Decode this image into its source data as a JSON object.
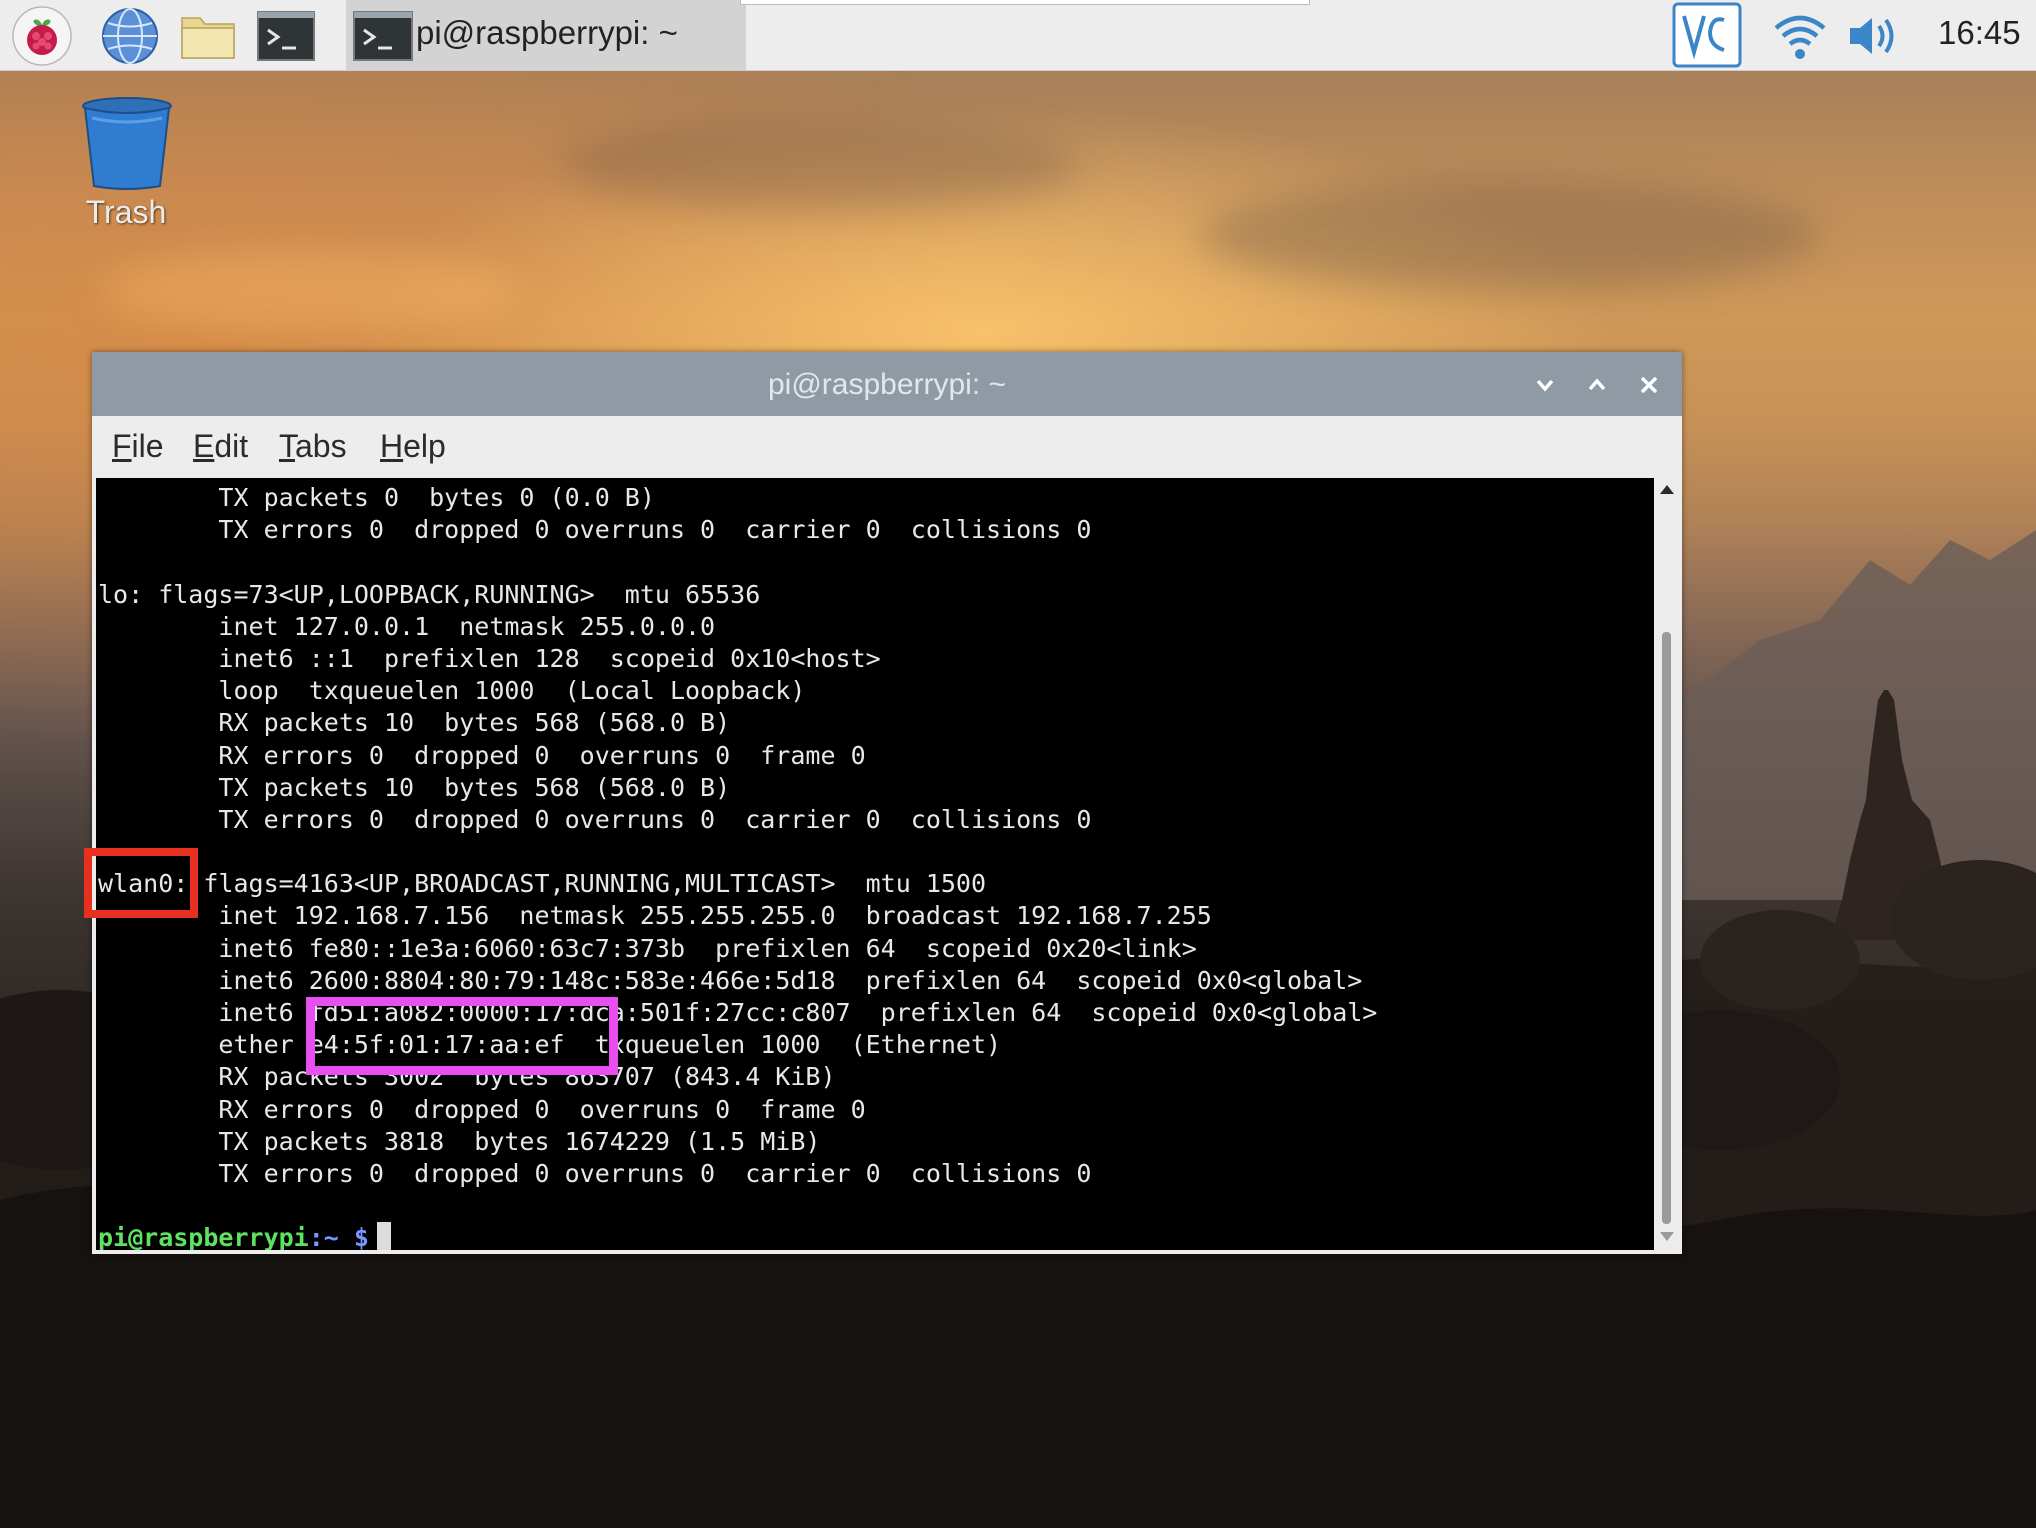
{
  "taskbar": {
    "launchers": [
      "raspberry-menu",
      "web-browser",
      "file-manager",
      "terminal"
    ],
    "window_button_title": "pi@raspberrypi: ~",
    "tray": [
      "vnc",
      "wifi",
      "volume"
    ],
    "clock": "16:45"
  },
  "desktop": {
    "trash_label": "Trash"
  },
  "terminal": {
    "title": "pi@raspberrypi: ~",
    "menu": [
      {
        "accel": "F",
        "rest": "ile"
      },
      {
        "accel": "E",
        "rest": "dit"
      },
      {
        "accel": "T",
        "rest": "abs"
      },
      {
        "accel": "H",
        "rest": "elp"
      }
    ],
    "lines": [
      "        TX packets 0  bytes 0 (0.0 B)",
      "        TX errors 0  dropped 0 overruns 0  carrier 0  collisions 0",
      "",
      "lo: flags=73<UP,LOOPBACK,RUNNING>  mtu 65536",
      "        inet 127.0.0.1  netmask 255.0.0.0",
      "        inet6 ::1  prefixlen 128  scopeid 0x10<host>",
      "        loop  txqueuelen 1000  (Local Loopback)",
      "        RX packets 10  bytes 568 (568.0 B)",
      "        RX errors 0  dropped 0  overruns 0  frame 0",
      "        TX packets 10  bytes 568 (568.0 B)",
      "        TX errors 0  dropped 0 overruns 0  carrier 0  collisions 0",
      "",
      "wlan0: flags=4163<UP,BROADCAST,RUNNING,MULTICAST>  mtu 1500",
      "        inet 192.168.7.156  netmask 255.255.255.0  broadcast 192.168.7.255",
      "        inet6 fe80::1e3a:6060:63c7:373b  prefixlen 64  scopeid 0x20<link>",
      "        inet6 2600:8804:80:79:148c:583e:466e:5d18  prefixlen 64  scopeid 0x0<global>",
      "        inet6 fd51:a082:0000:17:dca:501f:27cc:c807  prefixlen 64  scopeid 0x0<global>",
      "        ether e4:5f:01:17:aa:ef  txqueuelen 1000  (Ethernet)",
      "        RX packets 3002  bytes 863707 (843.4 KiB)",
      "        RX errors 0  dropped 0  overruns 0  frame 0",
      "        TX packets 3818  bytes 1674229 (1.5 MiB)",
      "        TX errors 0  dropped 0 overruns 0  carrier 0  collisions 0",
      ""
    ],
    "prompt_user": "pi@raspberrypi",
    "prompt_path": ":~ $"
  },
  "colors": {
    "titlebar": "#8f9aa4",
    "terminal_bg": "#000000",
    "terminal_fg": "#e8e8e8",
    "prompt_user": "#5fe25f",
    "prompt_symbol": "#7896ff",
    "highlight_wlan": "#e8301e",
    "highlight_mac": "#e84ef0"
  }
}
